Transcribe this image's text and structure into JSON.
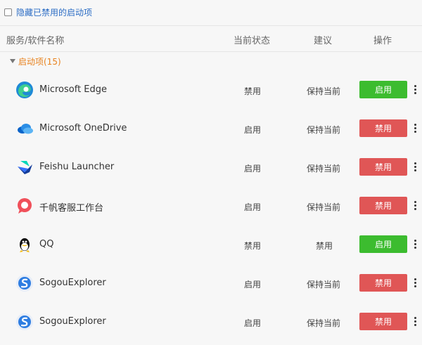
{
  "options": {
    "hide_disabled_label": "隐藏已禁用的启动项"
  },
  "table_header": {
    "name": "服务/软件名称",
    "status": "当前状态",
    "advice": "建议",
    "action": "操作"
  },
  "group": {
    "label": "启动项(15)"
  },
  "rows": [
    {
      "name": "Microsoft Edge",
      "status": "禁用",
      "advice": "保持当前",
      "action": "启用"
    },
    {
      "name": "Microsoft OneDrive",
      "status": "启用",
      "advice": "保持当前",
      "action": "禁用"
    },
    {
      "name": "Feishu Launcher",
      "status": "启用",
      "advice": "保持当前",
      "action": "禁用"
    },
    {
      "name": "千帆客服工作台",
      "status": "启用",
      "advice": "保持当前",
      "action": "禁用"
    },
    {
      "name": "QQ",
      "status": "禁用",
      "advice": "禁用",
      "action": "启用"
    },
    {
      "name": "SogouExplorer",
      "status": "启用",
      "advice": "保持当前",
      "action": "禁用"
    },
    {
      "name": "SogouExplorer",
      "status": "启用",
      "advice": "保持当前",
      "action": "禁用"
    }
  ],
  "colors": {
    "enable": "#3cbc2f",
    "disable": "#e05656",
    "group": "#e8821e",
    "link": "#2b6cc4"
  },
  "icons": [
    "edge-icon",
    "onedrive-icon",
    "feishu-icon",
    "qianfan-icon",
    "qq-icon",
    "sogou-icon",
    "sogou-icon"
  ]
}
